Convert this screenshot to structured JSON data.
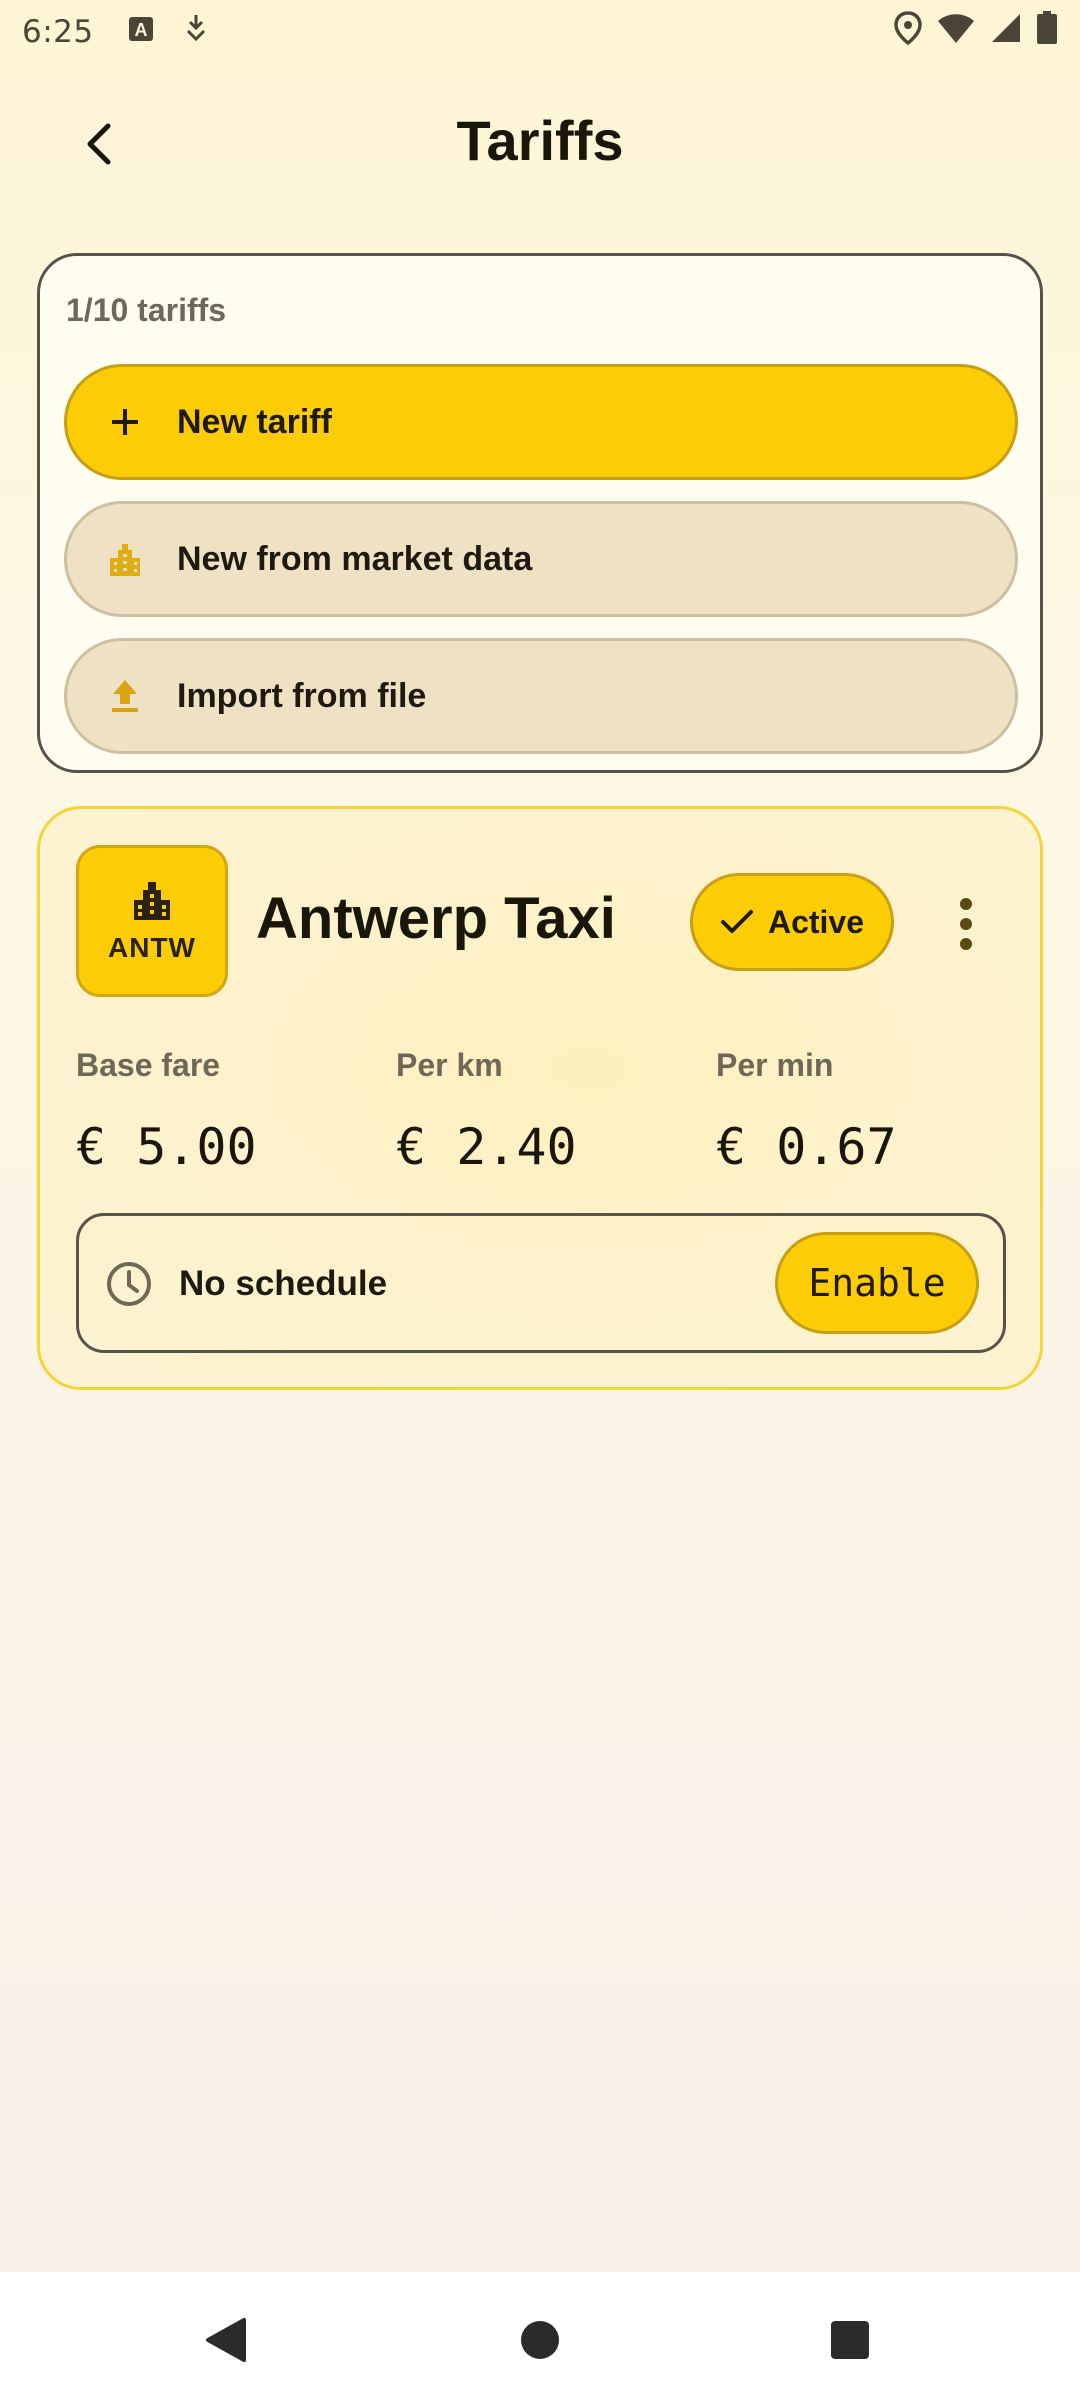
{
  "status_bar": {
    "time": "6:25",
    "left_icons": [
      "a-notification-icon",
      "download-notification-icon"
    ],
    "right_icons": [
      "location-icon",
      "wifi-icon",
      "cell-signal-icon",
      "battery-icon"
    ]
  },
  "header": {
    "title": "Tariffs",
    "back_icon": "chevron-left-icon"
  },
  "actions": {
    "count_label": "1/10 tariffs",
    "new_tariff_label": "New tariff",
    "market_label": "New from market data",
    "import_label": "Import from file"
  },
  "tariff": {
    "badge_code": "ANTW",
    "name": "Antwerp Taxi",
    "status_label": "Active",
    "fares": [
      {
        "label": "Base fare",
        "value": "€ 5.00"
      },
      {
        "label": "Per km",
        "value": "€ 2.40"
      },
      {
        "label": "Per min",
        "value": "€ 0.67"
      }
    ],
    "schedule_text": "No schedule",
    "enable_label": "Enable"
  },
  "colors": {
    "accent": "#fccc07",
    "secondary_button": "#efe2c4",
    "text": "#1f1a10",
    "muted_text": "#6e6858"
  }
}
